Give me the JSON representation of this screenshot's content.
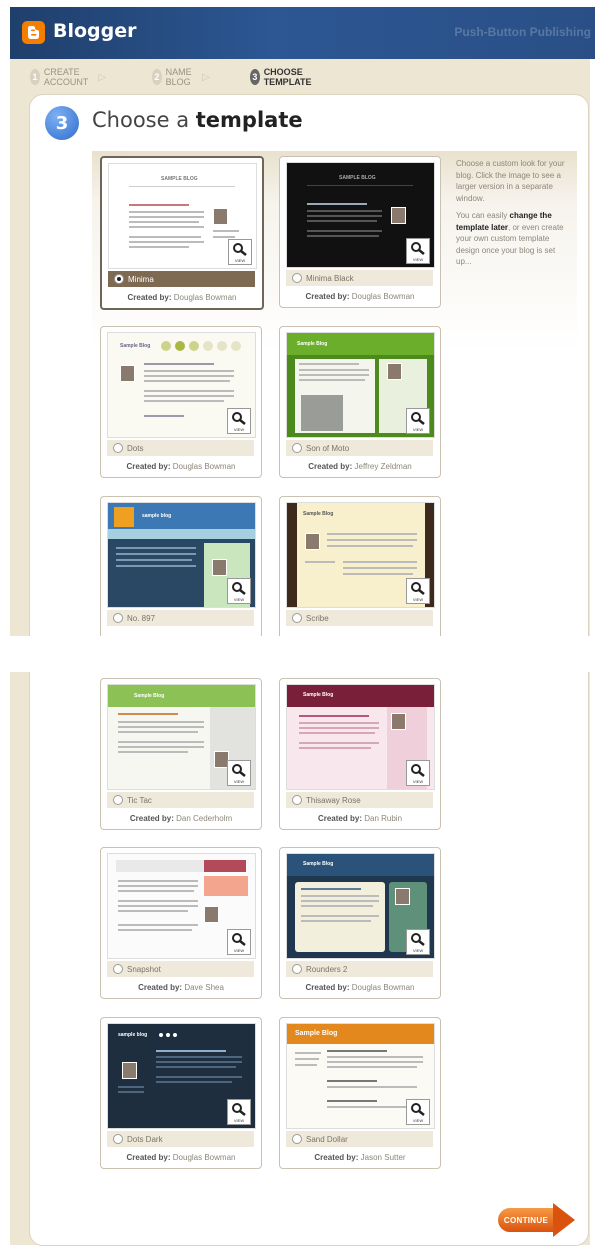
{
  "header": {
    "logo_text": "Blogger",
    "publisher": "Push-Button Publishing"
  },
  "steps": [
    {
      "number": "1",
      "label": "CREATE ACCOUNT"
    },
    {
      "number": "2",
      "label": "NAME BLOG"
    },
    {
      "number": "3",
      "label": "CHOOSE TEMPLATE",
      "active": true
    }
  ],
  "heading": {
    "number": "3",
    "title_prefix": "Choose a ",
    "title_bold": "template"
  },
  "help": {
    "p1": "Choose a custom look for your blog. Click the image to see a larger version in a separate window.",
    "p2_prefix": "You can easily ",
    "p2_bold": "change the template later",
    "p2_suffix": ", or even create your own custom template design once your blog is set up..."
  },
  "created_by_label": "Created by:",
  "view_label": "VIEW",
  "templates": [
    {
      "name": "Minima",
      "author": "Douglas Bowman",
      "selected": true
    },
    {
      "name": "Minima Black",
      "author": "Douglas Bowman"
    },
    {
      "name": "Dots",
      "author": "Douglas Bowman"
    },
    {
      "name": "Son of Moto",
      "author": "Jeffrey Zeldman"
    },
    {
      "name": "No. 897",
      "author": ""
    },
    {
      "name": "Scribe",
      "author": ""
    },
    {
      "name": "Tic Tac",
      "author": "Dan Cederholm"
    },
    {
      "name": "Thisaway Rose",
      "author": "Dan Rubin"
    },
    {
      "name": "Snapshot",
      "author": "Dave Shea"
    },
    {
      "name": "Rounders 2",
      "author": "Douglas Bowman"
    },
    {
      "name": "Dots Dark",
      "author": "Douglas Bowman"
    },
    {
      "name": "Sand Dollar",
      "author": "Jason Sutter"
    }
  ],
  "thumb_titles": {
    "minima": "SAMPLE BLOG",
    "minima_black": "SAMPLE BLOG",
    "dots": "Sample Blog",
    "son_of_moto": "Sample Blog",
    "no897": "sample blog",
    "scribe": "Sample Blog",
    "tic_tac": "Sample Blog",
    "thisaway_rose": "Sample Blog",
    "rounders2": "Sample Blog",
    "dots_dark": "sample blog",
    "sand_dollar": "Sample Blog"
  },
  "continue_label": "CONTINUE"
}
